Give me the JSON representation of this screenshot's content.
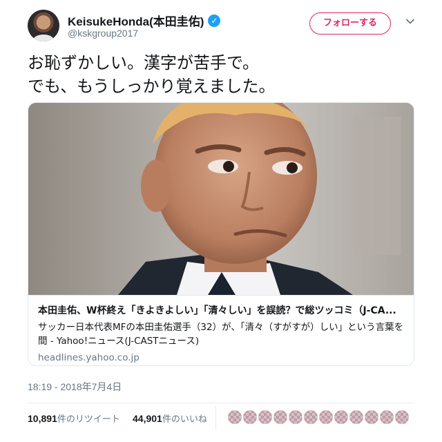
{
  "user": {
    "display_name": "KeisukeHonda(本田圭佑)",
    "handle": "@kskgroup2017",
    "verified_icon": "verified-check-icon",
    "colors": {
      "verified": "#1da1f2"
    }
  },
  "actions": {
    "follow_label": "フォローする",
    "more_icon": "chevron-down-icon",
    "colors": {
      "follow_accent": "#e0245e"
    }
  },
  "tweet": {
    "lines": [
      "お恥ずかしい。漢字が苦手で。",
      "でも、もうしっかり覚えました。"
    ],
    "timestamp": "18:19 - 2018年7月4日"
  },
  "card": {
    "title": "本田圭佑、W杯終え「きよきよしい」「清々しい」を誤読？で総ツッコミ（J-CA...",
    "description": "サッカー日本代表MFの本田圭佑選手（32）が、「清々（すがすが）しい」という言葉を間 - Yahoo!ニュース(J-CASTニュース)",
    "domain": "headlines.yahoo.co.jp"
  },
  "stats": {
    "retweets_count": "10,891",
    "retweets_label": "件のリツイート",
    "likes_count": "44,901",
    "likes_label": "件のいいね"
  }
}
